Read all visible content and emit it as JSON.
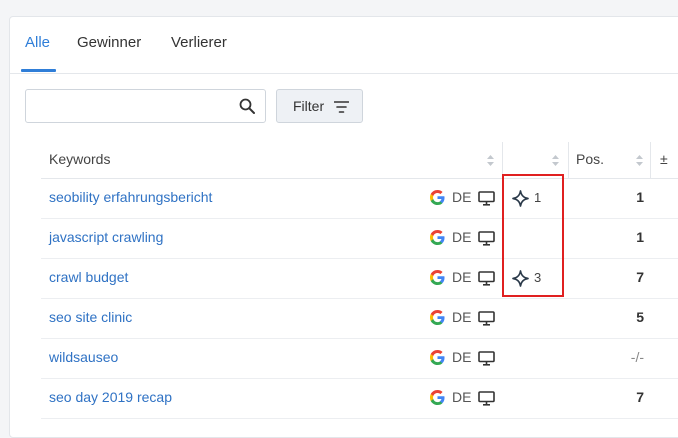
{
  "tabs": [
    {
      "label": "Alle",
      "active": true
    },
    {
      "label": "Gewinner",
      "active": false
    },
    {
      "label": "Verlierer",
      "active": false
    }
  ],
  "search": {
    "value": "",
    "placeholder": "",
    "icon": "search-icon"
  },
  "filter": {
    "label": "Filter",
    "icon": "filter-icon"
  },
  "table": {
    "headers": {
      "keywords": "Keywords",
      "features": "",
      "pos": "Pos.",
      "change": "±"
    },
    "rows": [
      {
        "keyword": "seobility erfahrungsbericht",
        "engine": "google",
        "country": "DE",
        "device": "desktop",
        "feature_count": "1",
        "pos": "1"
      },
      {
        "keyword": "javascript crawling",
        "engine": "google",
        "country": "DE",
        "device": "desktop",
        "feature_count": "",
        "pos": "1"
      },
      {
        "keyword": "crawl budget",
        "engine": "google",
        "country": "DE",
        "device": "desktop",
        "feature_count": "3",
        "pos": "7"
      },
      {
        "keyword": "seo site clinic",
        "engine": "google",
        "country": "DE",
        "device": "desktop",
        "feature_count": "",
        "pos": "5"
      },
      {
        "keyword": "wildsauseo",
        "engine": "google",
        "country": "DE",
        "device": "desktop",
        "feature_count": "",
        "pos": "-/-"
      },
      {
        "keyword": "seo day 2019 recap",
        "engine": "google",
        "country": "DE",
        "device": "desktop",
        "feature_count": "",
        "pos": "7"
      }
    ]
  },
  "colors": {
    "accent": "#2f7ed8",
    "link": "#2f72c4",
    "highlight": "#e02020"
  }
}
